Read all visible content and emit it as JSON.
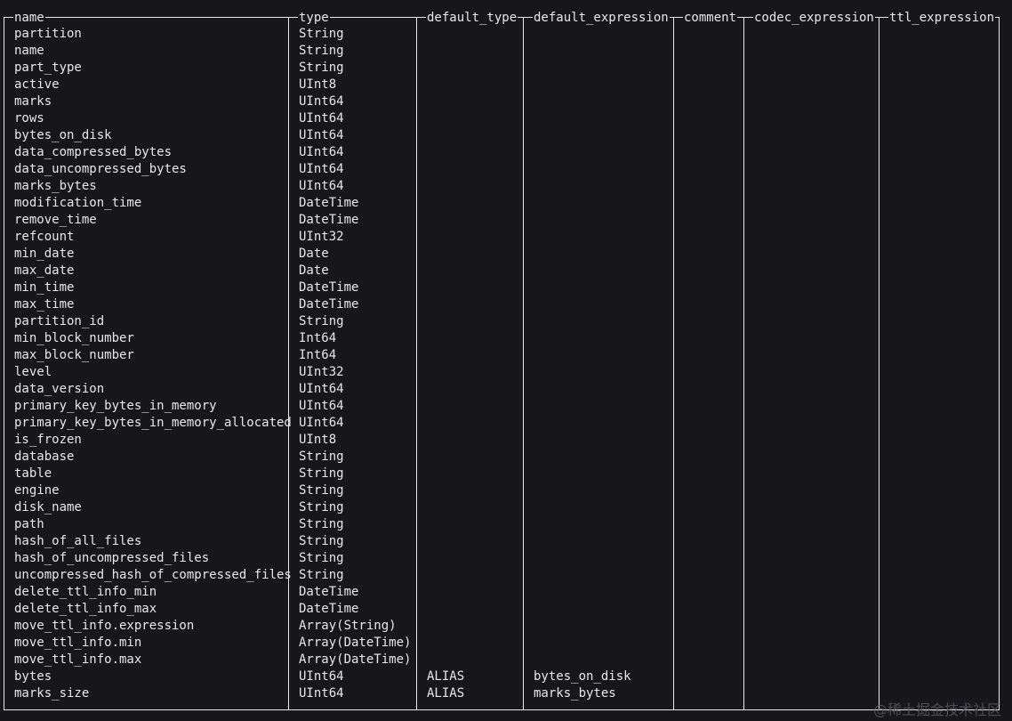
{
  "headers": [
    "name",
    "type",
    "default_type",
    "default_expression",
    "comment",
    "codec_expression",
    "ttl_expression"
  ],
  "rows": [
    [
      "partition",
      "String",
      "",
      "",
      "",
      "",
      ""
    ],
    [
      "name",
      "String",
      "",
      "",
      "",
      "",
      ""
    ],
    [
      "part_type",
      "String",
      "",
      "",
      "",
      "",
      ""
    ],
    [
      "active",
      "UInt8",
      "",
      "",
      "",
      "",
      ""
    ],
    [
      "marks",
      "UInt64",
      "",
      "",
      "",
      "",
      ""
    ],
    [
      "rows",
      "UInt64",
      "",
      "",
      "",
      "",
      ""
    ],
    [
      "bytes_on_disk",
      "UInt64",
      "",
      "",
      "",
      "",
      ""
    ],
    [
      "data_compressed_bytes",
      "UInt64",
      "",
      "",
      "",
      "",
      ""
    ],
    [
      "data_uncompressed_bytes",
      "UInt64",
      "",
      "",
      "",
      "",
      ""
    ],
    [
      "marks_bytes",
      "UInt64",
      "",
      "",
      "",
      "",
      ""
    ],
    [
      "modification_time",
      "DateTime",
      "",
      "",
      "",
      "",
      ""
    ],
    [
      "remove_time",
      "DateTime",
      "",
      "",
      "",
      "",
      ""
    ],
    [
      "refcount",
      "UInt32",
      "",
      "",
      "",
      "",
      ""
    ],
    [
      "min_date",
      "Date",
      "",
      "",
      "",
      "",
      ""
    ],
    [
      "max_date",
      "Date",
      "",
      "",
      "",
      "",
      ""
    ],
    [
      "min_time",
      "DateTime",
      "",
      "",
      "",
      "",
      ""
    ],
    [
      "max_time",
      "DateTime",
      "",
      "",
      "",
      "",
      ""
    ],
    [
      "partition_id",
      "String",
      "",
      "",
      "",
      "",
      ""
    ],
    [
      "min_block_number",
      "Int64",
      "",
      "",
      "",
      "",
      ""
    ],
    [
      "max_block_number",
      "Int64",
      "",
      "",
      "",
      "",
      ""
    ],
    [
      "level",
      "UInt32",
      "",
      "",
      "",
      "",
      ""
    ],
    [
      "data_version",
      "UInt64",
      "",
      "",
      "",
      "",
      ""
    ],
    [
      "primary_key_bytes_in_memory",
      "UInt64",
      "",
      "",
      "",
      "",
      ""
    ],
    [
      "primary_key_bytes_in_memory_allocated",
      "UInt64",
      "",
      "",
      "",
      "",
      ""
    ],
    [
      "is_frozen",
      "UInt8",
      "",
      "",
      "",
      "",
      ""
    ],
    [
      "database",
      "String",
      "",
      "",
      "",
      "",
      ""
    ],
    [
      "table",
      "String",
      "",
      "",
      "",
      "",
      ""
    ],
    [
      "engine",
      "String",
      "",
      "",
      "",
      "",
      ""
    ],
    [
      "disk_name",
      "String",
      "",
      "",
      "",
      "",
      ""
    ],
    [
      "path",
      "String",
      "",
      "",
      "",
      "",
      ""
    ],
    [
      "hash_of_all_files",
      "String",
      "",
      "",
      "",
      "",
      ""
    ],
    [
      "hash_of_uncompressed_files",
      "String",
      "",
      "",
      "",
      "",
      ""
    ],
    [
      "uncompressed_hash_of_compressed_files",
      "String",
      "",
      "",
      "",
      "",
      ""
    ],
    [
      "delete_ttl_info_min",
      "DateTime",
      "",
      "",
      "",
      "",
      ""
    ],
    [
      "delete_ttl_info_max",
      "DateTime",
      "",
      "",
      "",
      "",
      ""
    ],
    [
      "move_ttl_info.expression",
      "Array(String)",
      "",
      "",
      "",
      "",
      ""
    ],
    [
      "move_ttl_info.min",
      "Array(DateTime)",
      "",
      "",
      "",
      "",
      ""
    ],
    [
      "move_ttl_info.max",
      "Array(DateTime)",
      "",
      "",
      "",
      "",
      ""
    ],
    [
      "bytes",
      "UInt64",
      "ALIAS",
      "bytes_on_disk",
      "",
      "",
      ""
    ],
    [
      "marks_size",
      "UInt64",
      "ALIAS",
      "marks_bytes",
      "",
      "",
      ""
    ]
  ],
  "watermark": "@稀土掘金技术社区"
}
